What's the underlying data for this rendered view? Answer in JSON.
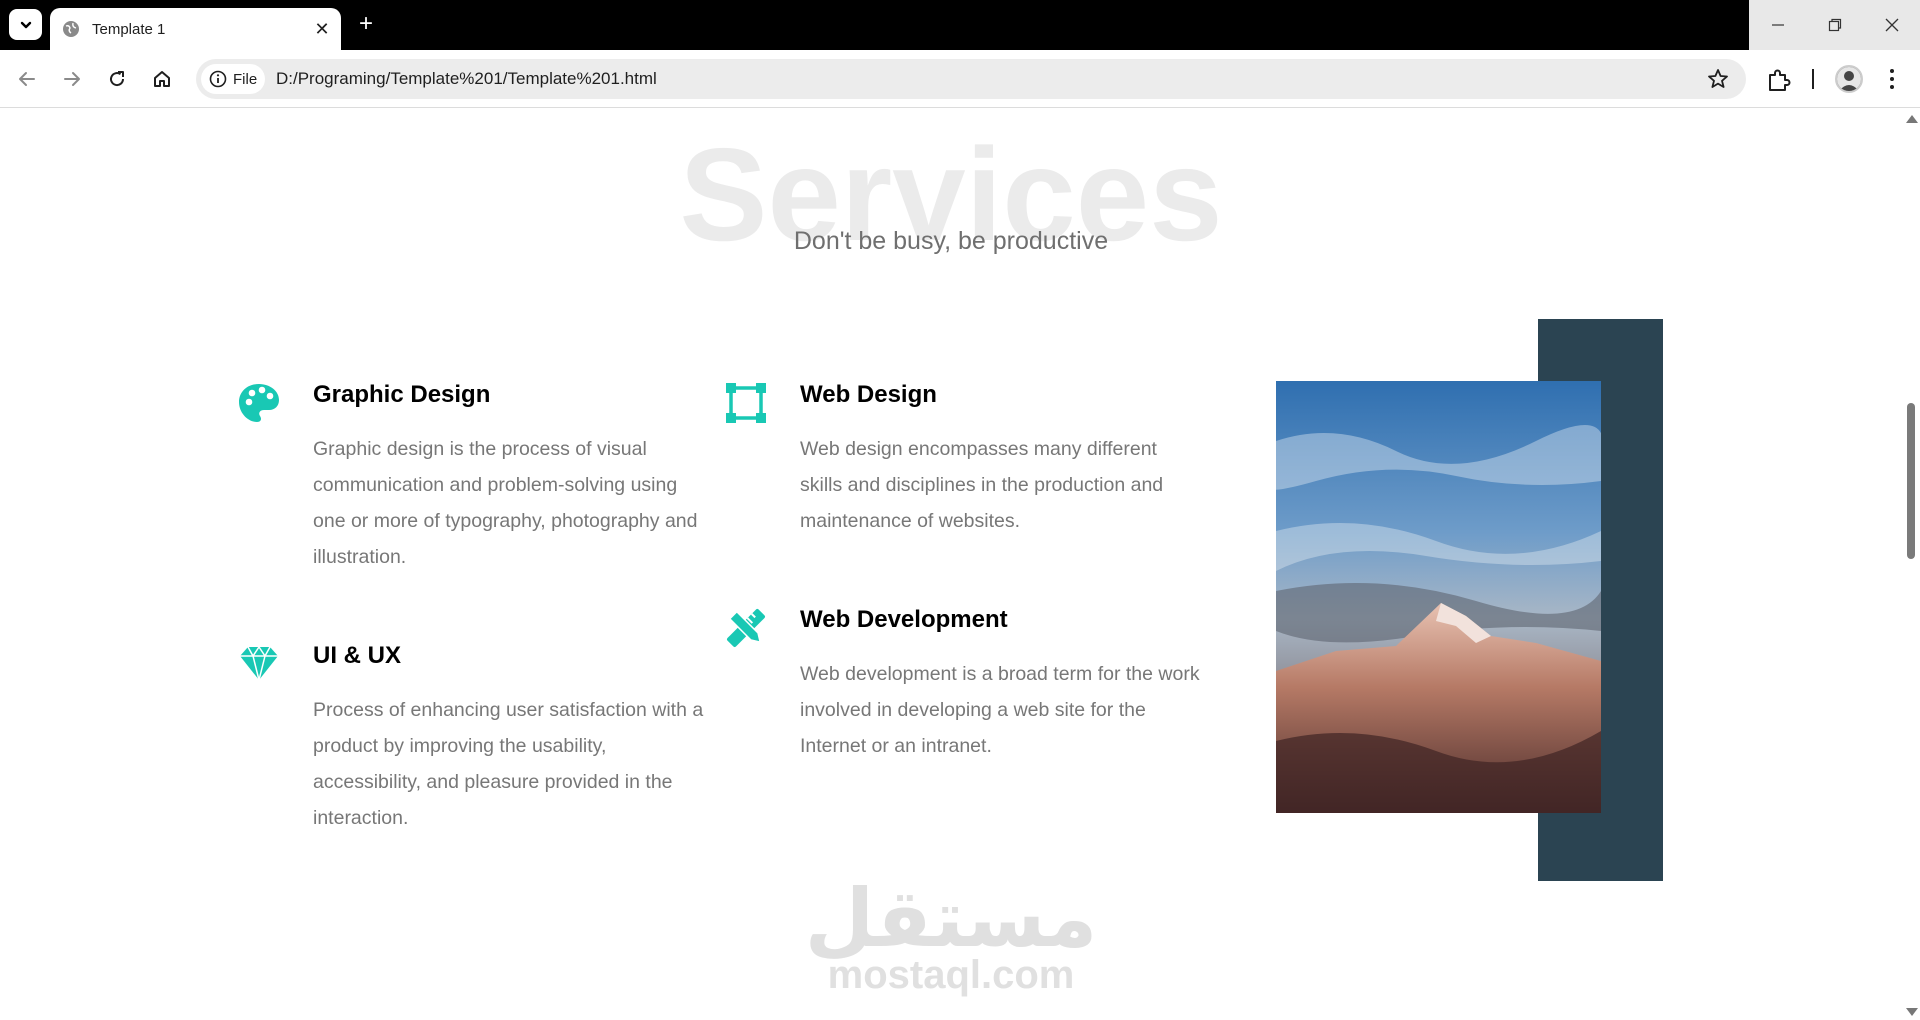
{
  "browser": {
    "tab_title": "Template 1",
    "new_tab_label": "+",
    "close_tab_label": "✕",
    "url_chip_label": "File",
    "url": "D:/Programing/Template%201/Template%201.html"
  },
  "page": {
    "background_heading": "Services",
    "subtitle": "Don't be busy, be productive",
    "services": [
      {
        "title": "Graphic Design",
        "description": "Graphic design is the process of visual communication and problem-solving using one or more of typography, photography and illustration.",
        "icon": "palette-icon"
      },
      {
        "title": "UI & UX",
        "description": "Process of enhancing user satisfaction with a product by improving the usability, accessibility, and pleasure provided in the interaction.",
        "icon": "diamond-icon"
      },
      {
        "title": "Web Design",
        "description": "Web design encompasses many different skills and disciplines in the production and maintenance of websites.",
        "icon": "vector-square-icon"
      },
      {
        "title": "Web Development",
        "description": "Web development is a broad term for the work involved in developing a web site for the Internet or an intranet.",
        "icon": "tools-icon"
      }
    ],
    "watermark_arabic": "مستقل",
    "watermark_latin": "mostaql.com"
  },
  "colors": {
    "accent": "#19c8b4",
    "image_backdrop": "#2b4452",
    "text_muted": "#777777"
  }
}
